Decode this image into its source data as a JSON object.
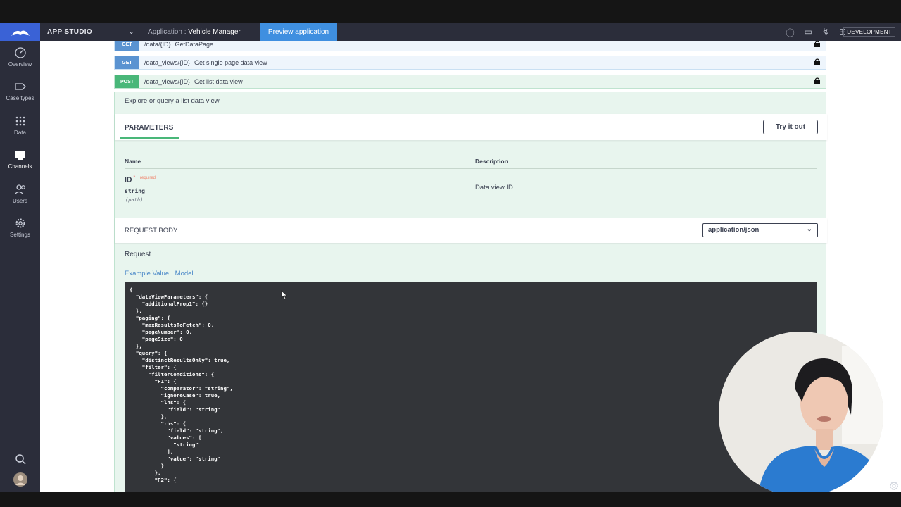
{
  "appbar": {
    "studio": "APP STUDIO",
    "app_prefix": "Application :",
    "app_name": "Vehicle Manager",
    "preview_label": "Preview application",
    "env": "DEVELOPMENT"
  },
  "sidebar": {
    "items": [
      {
        "label": "Overview"
      },
      {
        "label": "Case types"
      },
      {
        "label": "Data"
      },
      {
        "label": "Channels"
      },
      {
        "label": "Users"
      },
      {
        "label": "Settings"
      }
    ]
  },
  "operations": [
    {
      "method": "GET",
      "path": "/data/{ID}",
      "summary": "GetDataPage"
    },
    {
      "method": "GET",
      "path": "/data_views/{ID}",
      "summary": "Get single page data view"
    },
    {
      "method": "POST",
      "path": "/data_views/{ID}",
      "summary": "Get list data view"
    }
  ],
  "post_panel": {
    "description": "Explore or query a list data view",
    "parameters_title": "PARAMETERS",
    "try_label": "Try it out",
    "col_name": "Name",
    "col_description": "Description",
    "param": {
      "name": "ID",
      "required_mark": "*",
      "required_text": "required",
      "type": "string",
      "in": "(path)",
      "description": "Data view ID"
    },
    "request_body_title": "REQUEST BODY",
    "content_type": "application/json",
    "request_label": "Request",
    "tab_example": "Example Value",
    "tab_model": "Model",
    "code": "{\n  \"dataViewParameters\": {\n    \"additionalProp1\": {}\n  },\n  \"paging\": {\n    \"maxResultsToFetch\": 0,\n    \"pageNumber\": 0,\n    \"pageSize\": 0\n  },\n  \"query\": {\n    \"distinctResultsOnly\": true,\n    \"filter\": {\n      \"filterConditions\": {\n        \"F1\": {\n          \"comparator\": \"string\",\n          \"ignoreCase\": true,\n          \"lhs\": {\n            \"field\": \"string\"\n          },\n          \"rhs\": {\n            \"field\": \"string\",\n            \"values\": [\n              \"string\"\n            ],\n            \"value\": \"string\"\n          }\n        },\n        \"F2\": {"
  }
}
